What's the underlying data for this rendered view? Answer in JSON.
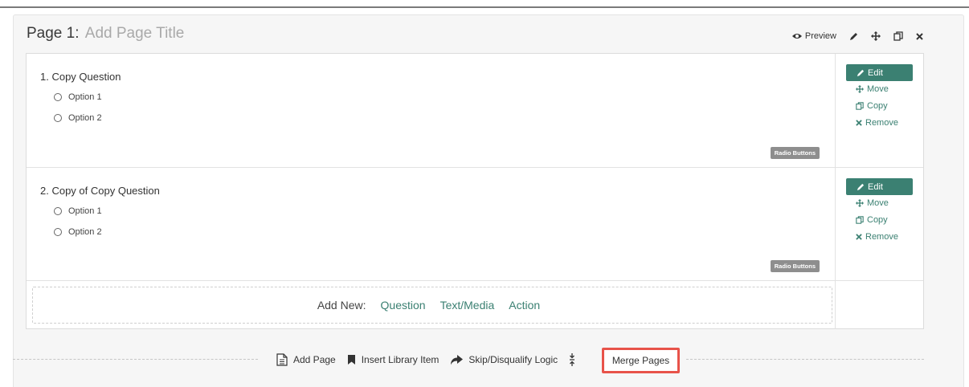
{
  "page": {
    "prefix": "Page 1:",
    "title_placeholder": "Add Page Title",
    "tools": {
      "preview_label": "Preview",
      "icons": [
        "eye-icon",
        "pencil-icon",
        "move-icon",
        "copy-icon",
        "close-icon"
      ]
    }
  },
  "questions": [
    {
      "title": "1. Copy Question",
      "options": [
        "Option 1",
        "Option 2"
      ],
      "type_badge": "Radio Buttons",
      "actions": {
        "edit": "Edit",
        "move": "Move",
        "copy": "Copy",
        "remove": "Remove"
      }
    },
    {
      "title": "2. Copy of Copy Question",
      "options": [
        "Option 1",
        "Option 2"
      ],
      "type_badge": "Radio Buttons",
      "actions": {
        "edit": "Edit",
        "move": "Move",
        "copy": "Copy",
        "remove": "Remove"
      }
    }
  ],
  "add_new": {
    "label": "Add New:",
    "links": [
      "Question",
      "Text/Media",
      "Action"
    ]
  },
  "bottom_actions": {
    "add_page": "Add Page",
    "insert_library_item": "Insert Library Item",
    "skip_logic": "Skip/Disqualify Logic",
    "merge_pages": "Merge Pages"
  },
  "colors": {
    "accent": "#3b8072",
    "highlight": "#e8534a",
    "badge": "#8e8e8e"
  }
}
